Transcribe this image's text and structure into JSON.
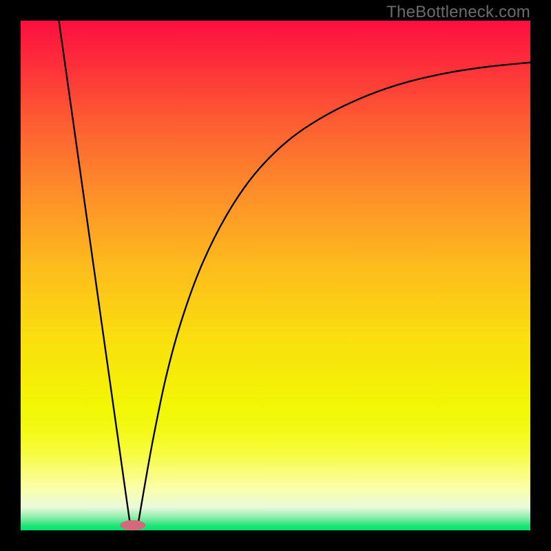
{
  "watermark": "TheBottleneck.com",
  "chart_data": {
    "type": "line",
    "title": "",
    "xlabel": "",
    "ylabel": "",
    "xlim": [
      0,
      100
    ],
    "ylim": [
      0,
      100
    ],
    "axes_visible": false,
    "background": "rainbow-vertical",
    "gradient_stops": [
      {
        "pos": 0.0,
        "value": 100,
        "color": "#fc0f3f"
      },
      {
        "pos": 0.08,
        "value": 92,
        "color": "#fd2c3b"
      },
      {
        "pos": 0.2,
        "value": 80,
        "color": "#fd5d32"
      },
      {
        "pos": 0.34,
        "value": 66,
        "color": "#fd8f29"
      },
      {
        "pos": 0.48,
        "value": 52,
        "color": "#fdbb1d"
      },
      {
        "pos": 0.62,
        "value": 38,
        "color": "#fade0e"
      },
      {
        "pos": 0.76,
        "value": 24,
        "color": "#f1f704"
      },
      {
        "pos": 0.81,
        "value": 19,
        "color": "#f4fa19"
      },
      {
        "pos": 0.85,
        "value": 15,
        "color": "#f7fc43"
      },
      {
        "pos": 0.92,
        "value": 8,
        "color": "#fbfeae"
      },
      {
        "pos": 0.955,
        "value": 4.5,
        "color": "#e9fada"
      },
      {
        "pos": 0.975,
        "value": 2.5,
        "color": "#8cedab"
      },
      {
        "pos": 0.99,
        "value": 1,
        "color": "#24e57a"
      },
      {
        "pos": 1.0,
        "value": 0,
        "color": "#00e36d"
      }
    ],
    "minimum_x": 22,
    "marker": {
      "x": 22,
      "y": 1,
      "rx": 2.5,
      "ry": 1.0,
      "color": "#d5697b"
    },
    "left_line": {
      "x_top": 7.5,
      "y_top": 100,
      "x_bot": 21.5,
      "y_bot": 1.0
    },
    "right_curve": {
      "description": "V-shaped bottleneck curve: right side rises from the marker and asymptotically flattens toward the top-right corner.",
      "points_xy": [
        [
          23.0,
          1.0
        ],
        [
          24.2,
          8.0
        ],
        [
          26.0,
          18.0
        ],
        [
          28.5,
          30.0
        ],
        [
          31.5,
          41.0
        ],
        [
          35.5,
          52.0
        ],
        [
          40.5,
          62.0
        ],
        [
          46.0,
          70.0
        ],
        [
          52.5,
          76.5
        ],
        [
          60.0,
          81.5
        ],
        [
          68.0,
          85.3
        ],
        [
          76.0,
          88.0
        ],
        [
          84.0,
          89.8
        ],
        [
          92.0,
          91.0
        ],
        [
          100.0,
          91.8
        ]
      ]
    }
  }
}
